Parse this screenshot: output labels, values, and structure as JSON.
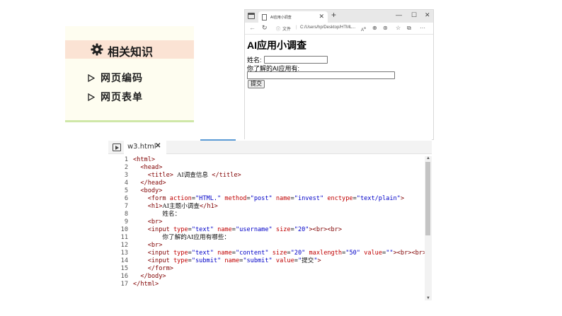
{
  "knowledge": {
    "title": "相关知识",
    "items": [
      "网页编码",
      "网页表单"
    ]
  },
  "browser": {
    "tab_title": "AI应用小调查",
    "tab_close": "✕",
    "new_tab": "+",
    "window_controls": [
      "—",
      "☐",
      "✕"
    ],
    "address_prefix": "文件",
    "address": "C:/Users/hp/Desktop/HTML...",
    "page": {
      "heading": "AI应用小调查",
      "name_label": "姓名:",
      "content_label": "你了解的AI应用有:",
      "submit_label": "提交"
    }
  },
  "editor": {
    "file_name": "w3.html",
    "close": "✕",
    "line_numbers": [
      "1",
      "2",
      "3",
      "4",
      "5",
      "6",
      "7",
      "8",
      "9",
      "10",
      "11",
      "12",
      "13",
      "14",
      "15",
      "16",
      "17"
    ]
  },
  "colors": {
    "tag": "#800000",
    "attribute": "#c00000",
    "value": "#0000c8",
    "card_bg": "#fefdf0",
    "card_header": "#fbe3d4",
    "card_border": "#cfe7a8"
  }
}
